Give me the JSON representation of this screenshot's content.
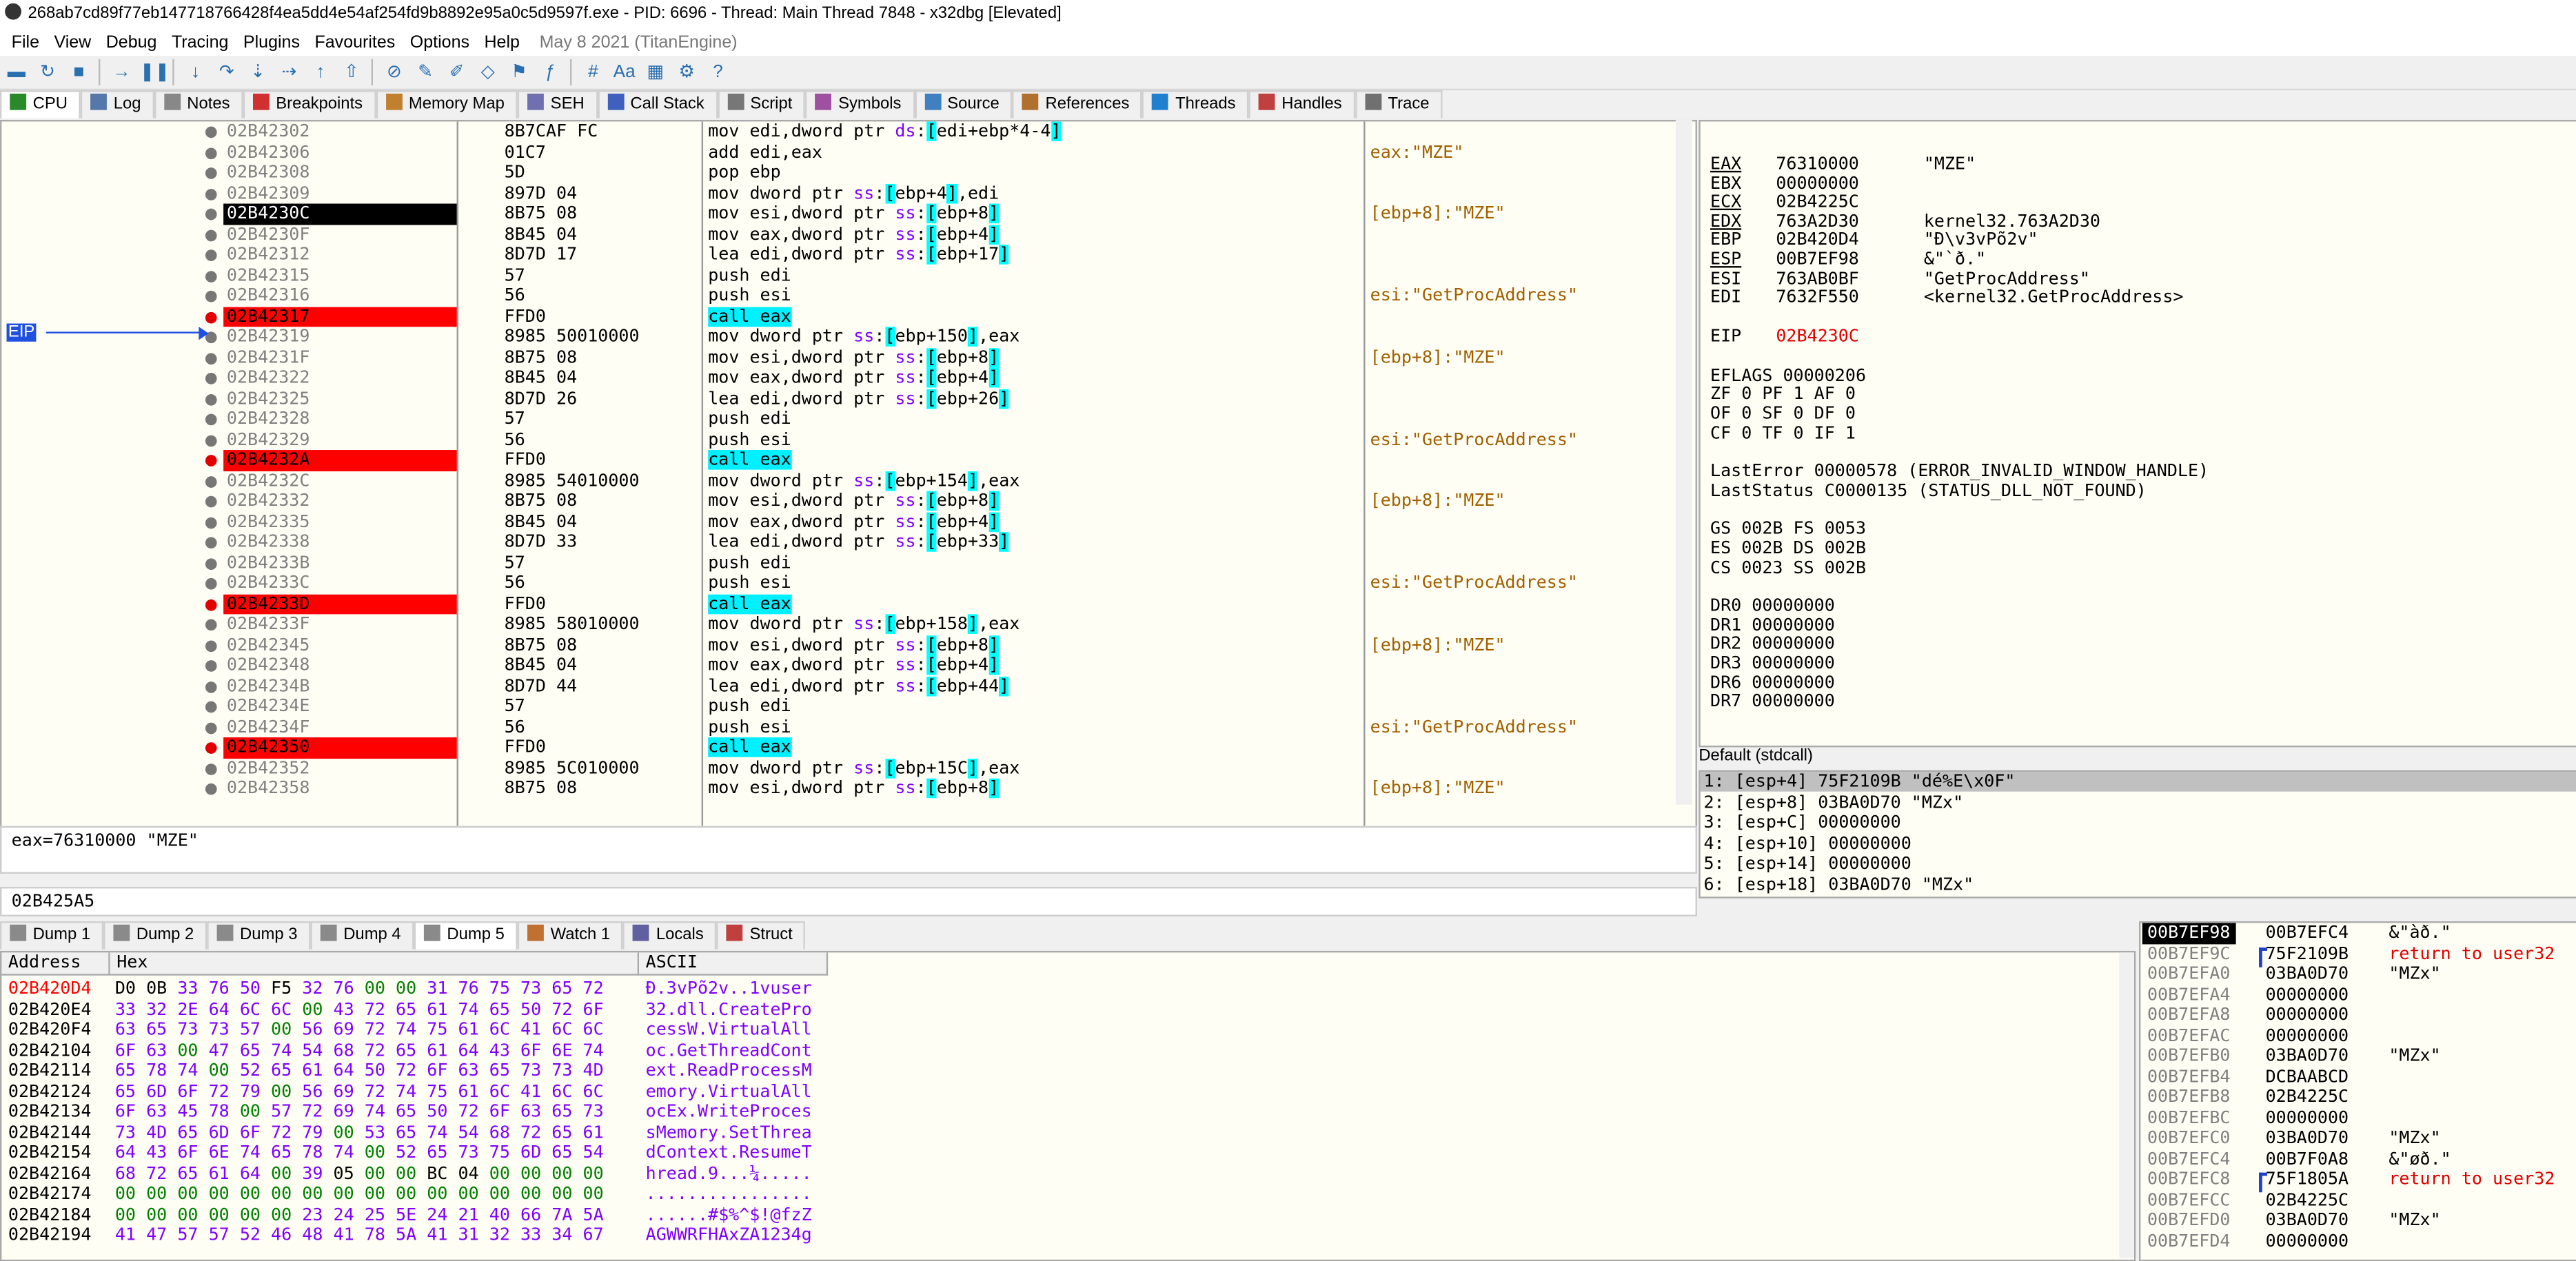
{
  "window": {
    "title": "268ab7cd89f77eb147718766428f4ea5dd4e54af254fd9b8892e95a0c5d9597f.exe - PID: 6696 - Thread: Main Thread 7848 - x32dbg [Elevated]"
  },
  "menu": {
    "items": [
      "File",
      "View",
      "Debug",
      "Tracing",
      "Plugins",
      "Favourites",
      "Options",
      "Help"
    ],
    "info": "May 8 2021 (TitanEngine)"
  },
  "tabs_top": [
    "CPU",
    "Log",
    "Notes",
    "Breakpoints",
    "Memory Map",
    "SEH",
    "Call Stack",
    "Script",
    "Symbols",
    "Source",
    "References",
    "Threads",
    "Handles",
    "Trace"
  ],
  "toolbar": {
    "icons": [
      "open-icon",
      "restart-icon",
      "stop-icon",
      "run-icon",
      "pause-icon",
      "step-into-icon",
      "step-over-icon",
      "trace-into-icon",
      "trace-over-icon",
      "execute-till-return-icon",
      "run-to-user-code-icon",
      "highlight-icon",
      "patch-icon",
      "comment-icon",
      "label-icon",
      "bookmark-icon",
      "function-icon",
      "hash-icon",
      "font-icon",
      "calculator-icon",
      "settings-icon",
      "help-icon"
    ]
  },
  "cpu": {
    "eip_label": "EIP",
    "rows": [
      {
        "addr": "02B42302",
        "bytes": "8B7CAF FC",
        "ins": "mov edi,dword ptr ds:[edi+ebp*4-4]",
        "cmt": ""
      },
      {
        "addr": "02B42306",
        "bytes": "01C7",
        "ins": "add edi,eax",
        "cmt": "eax:\"MZE\""
      },
      {
        "addr": "02B42308",
        "bytes": "5D",
        "ins": "pop ebp",
        "cmt": ""
      },
      {
        "addr": "02B42309",
        "bytes": "897D 04",
        "ins": "mov dword ptr ss:[ebp+4],edi",
        "cmt": ""
      },
      {
        "addr": "02B4230C",
        "bytes": "8B75 08",
        "ins": "mov esi,dword ptr ss:[ebp+8]",
        "cmt": "[ebp+8]:\"MZE\"",
        "cur": true
      },
      {
        "addr": "02B4230F",
        "bytes": "8B45 04",
        "ins": "mov eax,dword ptr ss:[ebp+4]",
        "cmt": ""
      },
      {
        "addr": "02B42312",
        "bytes": "8D7D 17",
        "ins": "lea edi,dword ptr ss:[ebp+17]",
        "cmt": ""
      },
      {
        "addr": "02B42315",
        "bytes": "57",
        "ins": "push edi",
        "cmt": ""
      },
      {
        "addr": "02B42316",
        "bytes": "56",
        "ins": "push esi",
        "cmt": "esi:\"GetProcAddress\""
      },
      {
        "addr": "02B42317",
        "bytes": "FFD0",
        "ins": "call eax",
        "cmt": "",
        "brk": true
      },
      {
        "addr": "02B42319",
        "bytes": "8985 50010000",
        "ins": "mov dword ptr ss:[ebp+150],eax",
        "cmt": ""
      },
      {
        "addr": "02B4231F",
        "bytes": "8B75 08",
        "ins": "mov esi,dword ptr ss:[ebp+8]",
        "cmt": "[ebp+8]:\"MZE\""
      },
      {
        "addr": "02B42322",
        "bytes": "8B45 04",
        "ins": "mov eax,dword ptr ss:[ebp+4]",
        "cmt": ""
      },
      {
        "addr": "02B42325",
        "bytes": "8D7D 26",
        "ins": "lea edi,dword ptr ss:[ebp+26]",
        "cmt": ""
      },
      {
        "addr": "02B42328",
        "bytes": "57",
        "ins": "push edi",
        "cmt": ""
      },
      {
        "addr": "02B42329",
        "bytes": "56",
        "ins": "push esi",
        "cmt": "esi:\"GetProcAddress\""
      },
      {
        "addr": "02B4232A",
        "bytes": "FFD0",
        "ins": "call eax",
        "cmt": "",
        "brk": true
      },
      {
        "addr": "02B4232C",
        "bytes": "8985 54010000",
        "ins": "mov dword ptr ss:[ebp+154],eax",
        "cmt": ""
      },
      {
        "addr": "02B42332",
        "bytes": "8B75 08",
        "ins": "mov esi,dword ptr ss:[ebp+8]",
        "cmt": "[ebp+8]:\"MZE\""
      },
      {
        "addr": "02B42335",
        "bytes": "8B45 04",
        "ins": "mov eax,dword ptr ss:[ebp+4]",
        "cmt": ""
      },
      {
        "addr": "02B42338",
        "bytes": "8D7D 33",
        "ins": "lea edi,dword ptr ss:[ebp+33]",
        "cmt": ""
      },
      {
        "addr": "02B4233B",
        "bytes": "57",
        "ins": "push edi",
        "cmt": ""
      },
      {
        "addr": "02B4233C",
        "bytes": "56",
        "ins": "push esi",
        "cmt": "esi:\"GetProcAddress\""
      },
      {
        "addr": "02B4233D",
        "bytes": "FFD0",
        "ins": "call eax",
        "cmt": "",
        "brk": true
      },
      {
        "addr": "02B4233F",
        "bytes": "8985 58010000",
        "ins": "mov dword ptr ss:[ebp+158],eax",
        "cmt": ""
      },
      {
        "addr": "02B42345",
        "bytes": "8B75 08",
        "ins": "mov esi,dword ptr ss:[ebp+8]",
        "cmt": "[ebp+8]:\"MZE\""
      },
      {
        "addr": "02B42348",
        "bytes": "8B45 04",
        "ins": "mov eax,dword ptr ss:[ebp+4]",
        "cmt": ""
      },
      {
        "addr": "02B4234B",
        "bytes": "8D7D 44",
        "ins": "lea edi,dword ptr ss:[ebp+44]",
        "cmt": ""
      },
      {
        "addr": "02B4234E",
        "bytes": "57",
        "ins": "push edi",
        "cmt": ""
      },
      {
        "addr": "02B4234F",
        "bytes": "56",
        "ins": "push esi",
        "cmt": "esi:\"GetProcAddress\""
      },
      {
        "addr": "02B42350",
        "bytes": "FFD0",
        "ins": "call eax",
        "cmt": "",
        "brk": true
      },
      {
        "addr": "02B42352",
        "bytes": "8985 5C010000",
        "ins": "mov dword ptr ss:[ebp+15C],eax",
        "cmt": ""
      },
      {
        "addr": "02B42358",
        "bytes": "8B75 08",
        "ins": "mov esi,dword ptr ss:[ebp+8]",
        "cmt": "[ebp+8]:\"MZE\""
      }
    ]
  },
  "registers": {
    "gp": [
      {
        "name": "EAX",
        "value": "76310000",
        "comment": "\"MZE\"",
        "und": true
      },
      {
        "name": "EBX",
        "value": "00000000",
        "comment": ""
      },
      {
        "name": "ECX",
        "value": "02B4225C",
        "comment": "",
        "und": true
      },
      {
        "name": "EDX",
        "value": "763A2D30",
        "comment": "kernel32.763A2D30",
        "und": true
      },
      {
        "name": "EBP",
        "value": "02B420D4",
        "comment": "\"Ð\\v3vPõ2v\""
      },
      {
        "name": "ESP",
        "value": "00B7EF98",
        "comment": "&\"`ð.\"",
        "und": true
      },
      {
        "name": "ESI",
        "value": "763AB0BF",
        "comment": "\"GetProcAddress\""
      },
      {
        "name": "EDI",
        "value": "7632F550",
        "comment": "<kernel32.GetProcAddress>"
      }
    ],
    "eip": {
      "name": "EIP",
      "value": "02B4230C"
    },
    "eflags": "EFLAGS   00000206",
    "flags": [
      "ZF 0  PF 1  AF 0",
      "OF 0  SF 0  DF 0",
      "CF 0  TF 0  IF 1"
    ],
    "last_error": "LastError  00000578 (ERROR_INVALID_WINDOW_HANDLE)",
    "last_status": "LastStatus C0000135 (STATUS_DLL_NOT_FOUND)",
    "segs": [
      "GS 002B  FS 0053",
      "ES 002B  DS 002B",
      "CS 0023  SS 002B"
    ],
    "dr": [
      "DR0 00000000",
      "DR1 00000000",
      "DR2 00000000",
      "DR3 00000000",
      "DR6 00000000",
      "DR7 00000000"
    ]
  },
  "callstack": {
    "header": "Default (stdcall)",
    "rows": [
      "1: [esp+4] 75F2109B \"dé%E\\x0F\"",
      "2: [esp+8] 03BA0D70 \"MZx\"",
      "3: [esp+C] 00000000",
      "4: [esp+10] 00000000",
      "5: [esp+14] 00000000",
      "6: [esp+18] 03BA0D70 \"MZx\""
    ]
  },
  "info": {
    "line1": "eax=76310000 \"MZE\"",
    "line2": "02B425A5"
  },
  "tabs_dump": [
    "Dump 1",
    "Dump 2",
    "Dump 3",
    "Dump 4",
    "Dump 5",
    "Watch 1",
    "Locals",
    "Struct"
  ],
  "dump": {
    "headers": {
      "address": "Address",
      "hex": "Hex",
      "ascii": "ASCII"
    },
    "rows": [
      {
        "addr": "02B420D4",
        "hex": "D0 0B 33 76 50 F5 32 76 00 00 31 76 75 73 65 72",
        "ascii": "Ð.3vPõ2v..1vuser"
      },
      {
        "addr": "02B420E4",
        "hex": "33 32 2E 64 6C 6C 00 43 72 65 61 74 65 50 72 6F",
        "ascii": "32.dll.CreatePro"
      },
      {
        "addr": "02B420F4",
        "hex": "63 65 73 73 57 00 56 69 72 74 75 61 6C 41 6C 6C",
        "ascii": "cessW.VirtualAll"
      },
      {
        "addr": "02B42104",
        "hex": "6F 63 00 47 65 74 54 68 72 65 61 64 43 6F 6E 74",
        "ascii": "oc.GetThreadCont"
      },
      {
        "addr": "02B42114",
        "hex": "65 78 74 00 52 65 61 64 50 72 6F 63 65 73 73 4D",
        "ascii": "ext.ReadProcessM"
      },
      {
        "addr": "02B42124",
        "hex": "65 6D 6F 72 79 00 56 69 72 74 75 61 6C 41 6C 6C",
        "ascii": "emory.VirtualAll"
      },
      {
        "addr": "02B42134",
        "hex": "6F 63 45 78 00 57 72 69 74 65 50 72 6F 63 65 73",
        "ascii": "ocEx.WriteProces"
      },
      {
        "addr": "02B42144",
        "hex": "73 4D 65 6D 6F 72 79 00 53 65 74 54 68 72 65 61",
        "ascii": "sMemory.SetThrea"
      },
      {
        "addr": "02B42154",
        "hex": "64 43 6F 6E 74 65 78 74 00 52 65 73 75 6D 65 54",
        "ascii": "dContext.ResumeT"
      },
      {
        "addr": "02B42164",
        "hex": "68 72 65 61 64 00 39 05 00 00 BC 04 00 00 00 00",
        "ascii": "hread.9...¼....."
      },
      {
        "addr": "02B42174",
        "hex": "00 00 00 00 00 00 00 00 00 00 00 00 00 00 00 00",
        "ascii": "................"
      },
      {
        "addr": "02B42184",
        "hex": "00 00 00 00 00 00 23 24 25 5E 24 21 40 66 7A 5A",
        "ascii": "......#$%^$!@fzZ"
      },
      {
        "addr": "02B42194",
        "hex": "41 47 57 57 52 46 48 41 78 5A 41 31 32 33 34 67",
        "ascii": "AGWWRFHAxZA1234g"
      }
    ]
  },
  "stack": {
    "rows": [
      {
        "addr": "00B7EF98",
        "val": "00B7EFC4",
        "cmt": "&\"àð.\"",
        "top": true
      },
      {
        "addr": "00B7EF9C",
        "val": "75F2109B",
        "cmt": "return to user32",
        "ret": true,
        "br": true
      },
      {
        "addr": "00B7EFA0",
        "val": "03BA0D70",
        "cmt": "\"MZx\""
      },
      {
        "addr": "00B7EFA4",
        "val": "00000000",
        "cmt": ""
      },
      {
        "addr": "00B7EFA8",
        "val": "00000000",
        "cmt": ""
      },
      {
        "addr": "00B7EFAC",
        "val": "00000000",
        "cmt": ""
      },
      {
        "addr": "00B7EFB0",
        "val": "03BA0D70",
        "cmt": "\"MZx\""
      },
      {
        "addr": "00B7EFB4",
        "val": "DCBAABCD",
        "cmt": ""
      },
      {
        "addr": "00B7EFB8",
        "val": "02B4225C",
        "cmt": ""
      },
      {
        "addr": "00B7EFBC",
        "val": "00000000",
        "cmt": ""
      },
      {
        "addr": "00B7EFC0",
        "val": "03BA0D70",
        "cmt": "\"MZx\""
      },
      {
        "addr": "00B7EFC4",
        "val": "00B7F0A8",
        "cmt": "&\"øð.\""
      },
      {
        "addr": "00B7EFC8",
        "val": "75F1805A",
        "cmt": "return to user32",
        "ret": true,
        "br": true
      },
      {
        "addr": "00B7EFCC",
        "val": "02B4225C",
        "cmt": ""
      },
      {
        "addr": "00B7EFD0",
        "val": "03BA0D70",
        "cmt": "\"MZx\""
      },
      {
        "addr": "00B7EFD4",
        "val": "00000000",
        "cmt": ""
      }
    ]
  },
  "colors": {
    "accent": "#2050e0",
    "breakpoint": "#ff0000",
    "highlight": "#00ffff",
    "panel_bg": "#fffef5"
  }
}
